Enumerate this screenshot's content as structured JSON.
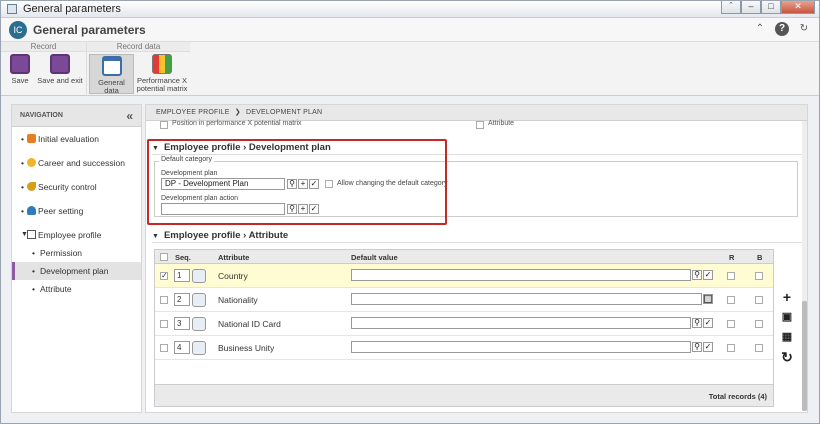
{
  "window": {
    "title": "General parameters",
    "controls": [
      "ˆ",
      "–",
      "□",
      "✕"
    ]
  },
  "app": {
    "title": "General parameters",
    "logo": "IC"
  },
  "ribbon": {
    "groups": [
      {
        "label": "Record"
      },
      {
        "label": "Record data"
      }
    ],
    "buttons": [
      {
        "label": "Save",
        "icon": "save-icon"
      },
      {
        "label": "Save and exit",
        "icon": "save-exit-icon"
      },
      {
        "label": "General data",
        "icon": "general-data-icon"
      },
      {
        "label": "Performance X potential matrix",
        "icon": "matrix-icon"
      }
    ]
  },
  "nav": {
    "title": "NAVIGATION",
    "items": [
      {
        "label": "Initial evaluation"
      },
      {
        "label": "Career and succession"
      },
      {
        "label": "Security control"
      },
      {
        "label": "Peer setting"
      },
      {
        "label": "Employee profile"
      },
      {
        "label": "Permission"
      },
      {
        "label": "Development plan"
      },
      {
        "label": "Attribute"
      }
    ]
  },
  "breadcrumb": {
    "part1": "EMPLOYEE PROFILE",
    "sep": "❯",
    "part2": "DEVELOPMENT PLAN"
  },
  "cut_row": {
    "left": "Position in performance X potential matrix",
    "right": "Attribute"
  },
  "dev_section": {
    "title": "Employee profile › Development plan",
    "legend": "Default category",
    "plan_label": "Development plan",
    "plan_value": "DP - Development Plan",
    "allow_label": "Allow changing the default category",
    "action_label": "Development plan action",
    "action_value": ""
  },
  "attr_section": {
    "title": "Employee profile › Attribute",
    "columns": {
      "seq": "Seq.",
      "attribute": "Attribute",
      "default": "Default value",
      "r": "R",
      "b": "B"
    },
    "rows": [
      {
        "seq": "1",
        "attribute": "Country",
        "checked": true
      },
      {
        "seq": "2",
        "attribute": "Nationality",
        "checked": false
      },
      {
        "seq": "3",
        "attribute": "National ID Card",
        "checked": false
      },
      {
        "seq": "4",
        "attribute": "Business Unity",
        "checked": false
      }
    ],
    "total": "Total records (4)"
  },
  "colors": {
    "accent": "#8e5aa6",
    "highlight": "#c62828",
    "row_highlight": "#fffbd3"
  }
}
